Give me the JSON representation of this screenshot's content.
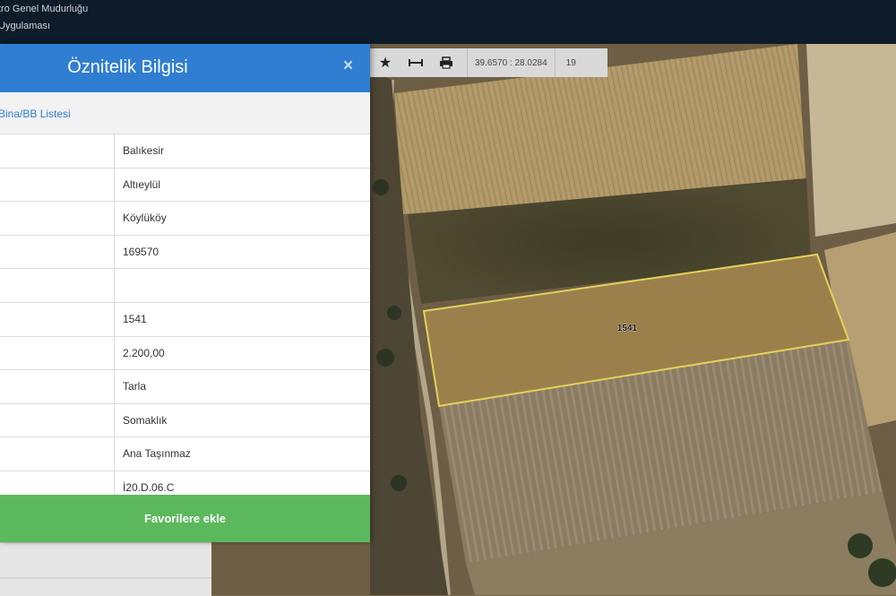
{
  "app": {
    "line1": "tro Genel Mudurluğu",
    "line2": "Uygulaması"
  },
  "toolbar": {
    "icons": [
      "star-icon",
      "measure-icon",
      "print-icon"
    ],
    "coordinates": "39.6570 : 28.0284",
    "zoom": "19"
  },
  "panel": {
    "title": "Öznitelik Bilgisi",
    "close": "×",
    "subtitle": "Bina/BB Listesi",
    "rows": [
      {
        "value": "Balıkesir"
      },
      {
        "value": "Altıeylül"
      },
      {
        "value": "Köylüköy"
      },
      {
        "value": "169570"
      },
      {
        "value": ""
      },
      {
        "value": "1541"
      },
      {
        "value": "2.200,00"
      },
      {
        "value": "Tarla"
      },
      {
        "value": "Somaklık"
      },
      {
        "value": "Ana Taşınmaz"
      },
      {
        "value": "İ20.D.06.C"
      }
    ],
    "footer_button": "Favorilere ekle"
  },
  "map": {
    "parcel_label": "1541",
    "parcel_color": "#e3d25a"
  }
}
